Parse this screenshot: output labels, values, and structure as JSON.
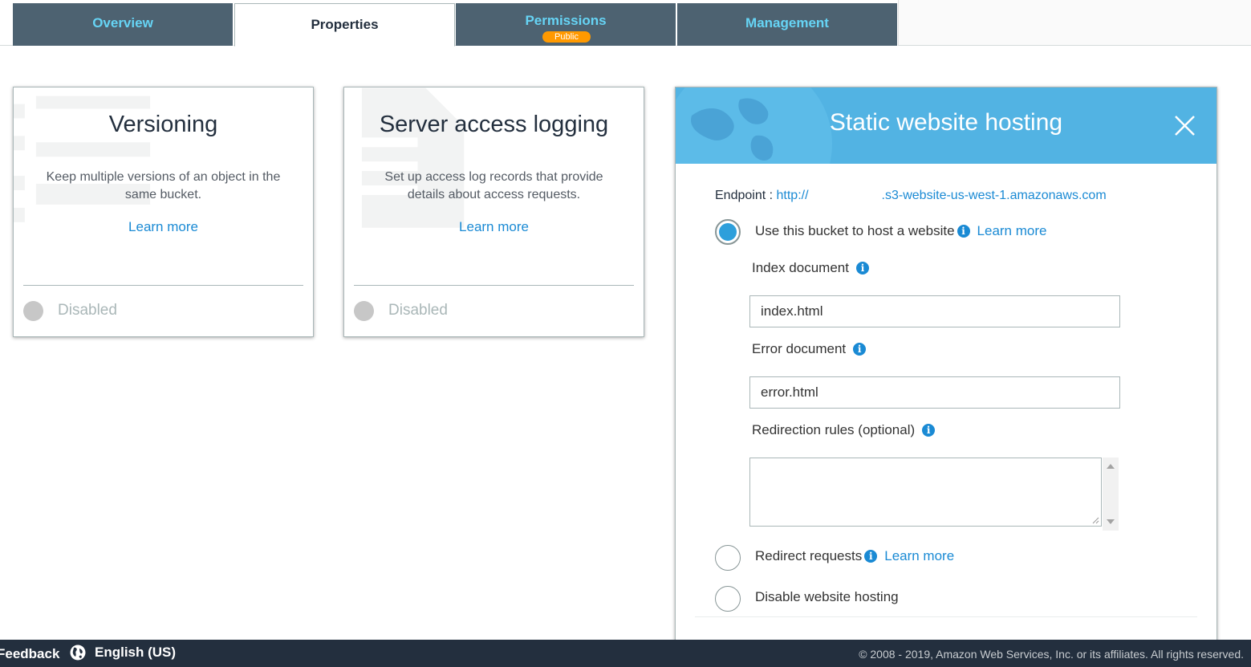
{
  "tabs": {
    "overview": "Overview",
    "properties": "Properties",
    "permissions": "Permissions",
    "permissions_badge": "Public",
    "management": "Management"
  },
  "versioning": {
    "title": "Versioning",
    "desc_line1": "Keep multiple versions of an object in the",
    "desc_line2": "same bucket.",
    "learn_more": "Learn more",
    "status": "Disabled"
  },
  "logging": {
    "title": "Server access logging",
    "desc_line1": "Set up access log records that provide",
    "desc_line2": "details about access requests.",
    "learn_more": "Learn more",
    "status": "Disabled"
  },
  "hosting": {
    "title": "Static website hosting",
    "endpoint_label": "Endpoint :",
    "endpoint_prefix": "http://",
    "endpoint_suffix": ".s3-website-us-west-1.amazonaws.com",
    "option_host": "Use this bucket to host a website",
    "option_host_learn": "Learn more",
    "index_label": "Index document",
    "index_value": "index.html",
    "error_label": "Error document",
    "error_value": "error.html",
    "redirection_label": "Redirection rules (optional)",
    "redirection_value": "",
    "option_redirect": "Redirect requests",
    "option_redirect_learn": "Learn more",
    "option_disable": "Disable website hosting",
    "selected_option": "host",
    "accent_color": "#52b3e3"
  },
  "footer": {
    "feedback": "Feedback",
    "language": "English (US)",
    "copyright": "© 2008 - 2019, Amazon Web Services, Inc. or its affiliates. All rights reserved."
  },
  "colors": {
    "tab_bg": "#4d6271",
    "tab_text": "#66d4f5",
    "badge": "#ff9900",
    "link": "#1a8ad4",
    "footer_bg": "#232f3e"
  }
}
